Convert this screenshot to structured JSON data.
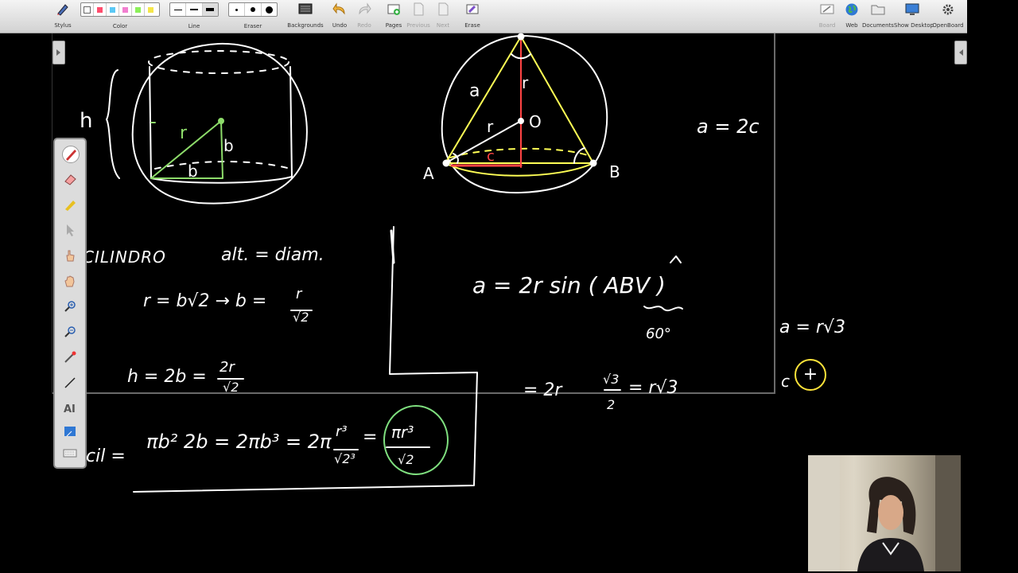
{
  "toolbar": {
    "stylus": "Stylus",
    "color": "Color",
    "line": "Line",
    "eraser": "Eraser",
    "backgrounds": "Backgrounds",
    "undo": "Undo",
    "redo": "Redo",
    "pages": "Pages",
    "previous": "Previous",
    "next": "Next",
    "erase": "Erase",
    "board": "Board",
    "web": "Web",
    "documents": "Documents",
    "show_desktop": "Show Desktop",
    "openboard": "OpenBoard"
  },
  "colors": {
    "swatches": [
      "#ffffff",
      "#ff4d6d",
      "#5bc8f5",
      "#f27fd0",
      "#8cf05a",
      "#f5e64a"
    ],
    "accent_yellow": "#ffff55",
    "accent_green": "#7fe07f",
    "accent_red": "#ff4444"
  },
  "board": {
    "labels": {
      "h": "h",
      "r": "r",
      "b": "b",
      "a": "a",
      "O": "O",
      "A": "A",
      "B": "B",
      "c": "c"
    },
    "notes": {
      "cilindro": "CILINDRO",
      "alt_diam": "alt. = diam.",
      "r_eq": "r = b√2  →  b =",
      "r_frac_num": "r",
      "r_frac_den": "√2",
      "h_eq": "h = 2b =",
      "h_frac_num": "2r",
      "h_frac_den": "√2",
      "vol_lead": "cil =",
      "vol_eq": "πb² 2b = 2πb³ = 2π",
      "vol_frac_num": "r³",
      "vol_frac_den": "√2³",
      "vol_eq2": "=",
      "vol_final_num": "πr³",
      "vol_final_den": "√2",
      "a_2c": "a = 2c",
      "sine_law": "a  =  2r sin ( ABV )",
      "angle_60": "60°",
      "sine_result_lead": "= 2r",
      "sqrt3": "√3",
      "two": "2",
      "sine_result_tail": "=  r√3",
      "a_rsqrt3": "a = r√3",
      "c_partial": "c"
    }
  }
}
